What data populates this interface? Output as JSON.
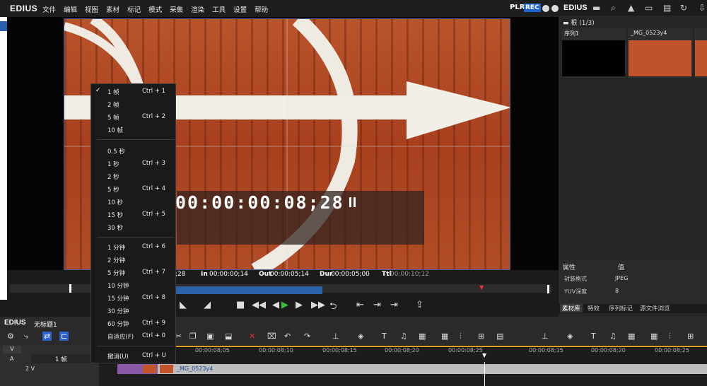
{
  "app": {
    "logo": "EDIUS"
  },
  "menubar": {
    "items": [
      "文件",
      "编辑",
      "视图",
      "素材",
      "标记",
      "模式",
      "采集",
      "渲染",
      "工具",
      "设置",
      "帮助"
    ],
    "plr": "PLR",
    "rec": "REC"
  },
  "player": {
    "timecode": "00:00:00:08;28",
    "tc_in_label": "In",
    "tc_in": "00:00:00;14",
    "tc_out_label": "Out",
    "tc_out": "00:00:05;14",
    "tc_dur_label": "Dur",
    "tc_dur": "00:00:05;00",
    "tc_ttl_label": "Ttl",
    "tc_ttl": "00:00:10;12",
    "tc_left_fragment": ";28"
  },
  "bin": {
    "logo": "EDIUS",
    "root": "根 (1/3)",
    "clips": [
      {
        "name": "序列1"
      },
      {
        "name": "_MG_0523y4"
      }
    ]
  },
  "properties": {
    "header_attr": "属性",
    "header_val": "值",
    "rows": [
      {
        "attr": "封装格式",
        "val": "JPEG"
      },
      {
        "attr": "YUV深度",
        "val": "8"
      }
    ]
  },
  "panel_tabs": [
    "素材库",
    "特效",
    "序列标记",
    "源文件浏览"
  ],
  "timeline": {
    "logo": "EDIUS",
    "name": "无标题1",
    "track_v": "V",
    "track_a": "A",
    "track_2v": "2 V",
    "step_value": "1 帧",
    "ruler": [
      "00:00:08;05",
      "00:00:08;10",
      "00:00:08;15",
      "00:00:08;20",
      "00:00:08;25",
      "00:00:08;15",
      "00:00:08;20",
      "00:00:08;25"
    ],
    "clip_name": "_MG_0523y4"
  },
  "context_menu": [
    {
      "label": "1 帧",
      "shortcut": "Ctrl + 1",
      "checked": true
    },
    {
      "label": "2 帧",
      "shortcut": ""
    },
    {
      "label": "5 帧",
      "shortcut": "Ctrl + 2"
    },
    {
      "label": "10 帧",
      "shortcut": ""
    },
    {
      "label": "0.5 秒",
      "shortcut": ""
    },
    {
      "label": "1 秒",
      "shortcut": "Ctrl + 3"
    },
    {
      "label": "2 秒",
      "shortcut": ""
    },
    {
      "label": "5 秒",
      "shortcut": "Ctrl + 4"
    },
    {
      "label": "10 秒",
      "shortcut": ""
    },
    {
      "label": "15 秒",
      "shortcut": "Ctrl + 5"
    },
    {
      "label": "30 秒",
      "shortcut": ""
    },
    {
      "label": "1 分钟",
      "shortcut": "Ctrl + 6"
    },
    {
      "label": "2 分钟",
      "shortcut": ""
    },
    {
      "label": "5 分钟",
      "shortcut": "Ctrl + 7"
    },
    {
      "label": "10 分钟",
      "shortcut": ""
    },
    {
      "label": "15 分钟",
      "shortcut": "Ctrl + 8"
    },
    {
      "label": "30 分钟",
      "shortcut": ""
    },
    {
      "label": "60 分钟",
      "shortcut": "Ctrl + 9"
    },
    {
      "label": "自适应(F)",
      "shortcut": "Ctrl + 0"
    },
    {
      "label": "撤消(U)",
      "shortcut": "Ctrl + U"
    }
  ],
  "colors": {
    "accent": "#1e64d0",
    "scrub_fill": "#2a62a8"
  }
}
